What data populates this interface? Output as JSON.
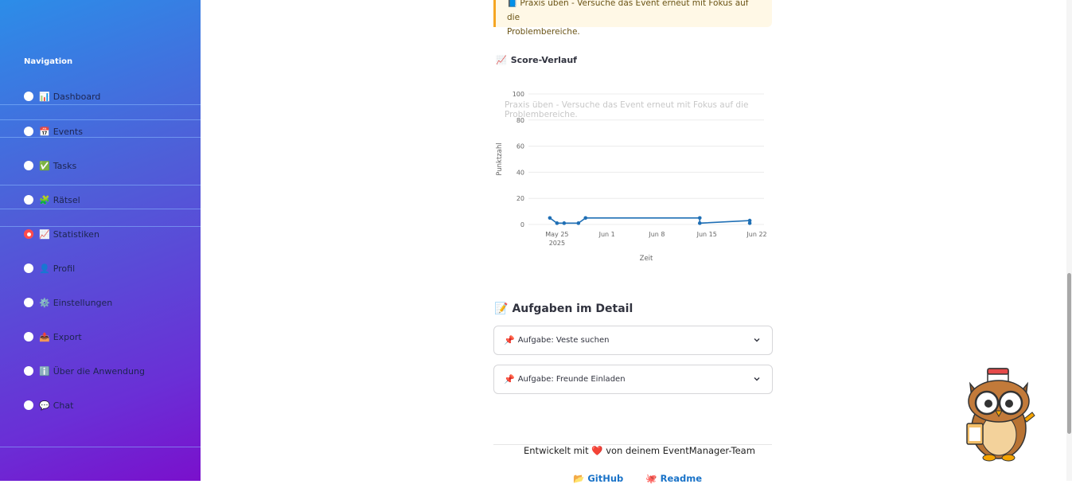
{
  "sidebar": {
    "title": "Navigation",
    "items": [
      {
        "icon": "📊",
        "label": "Dashboard",
        "selected": false
      },
      {
        "icon": "📅",
        "label": "Events",
        "selected": false
      },
      {
        "icon": "✅",
        "label": "Tasks",
        "selected": false
      },
      {
        "icon": "🧩",
        "label": "Rätsel",
        "selected": false
      },
      {
        "icon": "📈",
        "label": "Statistiken",
        "selected": true
      },
      {
        "icon": "👤",
        "label": "Profil",
        "selected": false
      },
      {
        "icon": "⚙️",
        "label": "Einstellungen",
        "selected": false
      },
      {
        "icon": "📤",
        "label": "Export",
        "selected": false
      },
      {
        "icon": "ℹ️",
        "label": "Über die Anwendung",
        "selected": false
      },
      {
        "icon": "💬",
        "label": "Chat",
        "selected": false
      }
    ]
  },
  "info": {
    "icon": "📘",
    "line1": "Praxis üben - Versuche das Event erneut mit Fokus auf die",
    "line2": "Problembereiche."
  },
  "score_section": {
    "icon": "📈",
    "title": "Score-Verlauf"
  },
  "chart_data": {
    "type": "line",
    "xlabel": "Zeit",
    "ylabel": "Punktzahl",
    "ylim": [
      0,
      100
    ],
    "yticks": [
      0,
      20,
      40,
      60,
      80,
      100
    ],
    "xticks": [
      "May 25\n2025",
      "Jun 1",
      "Jun 8",
      "Jun 15",
      "Jun 22"
    ],
    "series": [
      {
        "x": [
          "2025-05-24",
          "2025-05-25",
          "2025-05-26",
          "2025-05-28",
          "2025-05-29",
          "2025-06-14",
          "2025-06-14",
          "2025-06-21",
          "2025-06-21"
        ],
        "y": [
          5,
          1,
          1,
          1,
          5,
          5,
          1,
          3,
          1
        ]
      }
    ],
    "grid": true,
    "color": "#1f6fb5"
  },
  "tasks_section": {
    "icon": "📝",
    "title": "Aufgaben im Detail",
    "items": [
      {
        "icon": "📌",
        "label": "Aufgabe: Veste suchen"
      },
      {
        "icon": "📌",
        "label": "Aufgabe: Freunde Einladen"
      }
    ]
  },
  "footer": {
    "text": "Entwickelt mit ❤️ von deinem EventManager-Team",
    "links": [
      {
        "icon": "📂",
        "label": "GitHub"
      },
      {
        "icon": "🐙",
        "label": "Readme"
      }
    ]
  },
  "colors": {
    "accent": "#ff4b4b",
    "chart_line": "#1f6fb5",
    "info_border": "#f5a623"
  }
}
